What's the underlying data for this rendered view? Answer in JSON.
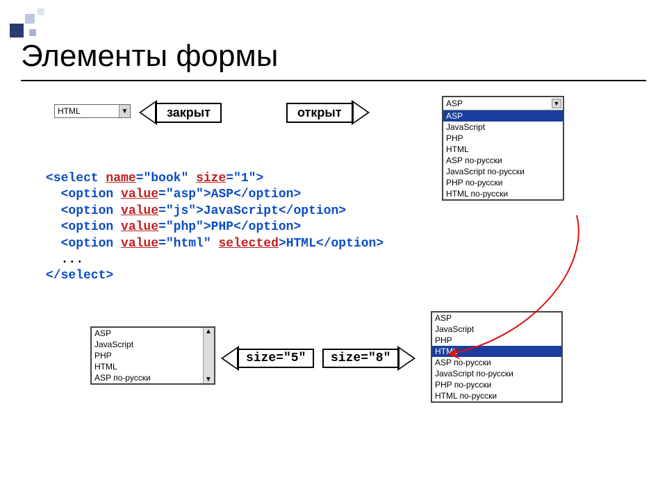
{
  "title": "Элементы формы",
  "labels": {
    "closed": "закрыт",
    "open": "открыт",
    "size5": "size=\"5\"",
    "size8": "size=\"8\""
  },
  "closed_select_value": "HTML",
  "open_listbox": {
    "value": "ASP",
    "selected_index": 0,
    "options": [
      "ASP",
      "JavaScript",
      "PHP",
      "HTML",
      "ASP по-русски",
      "JavaScript по-русски",
      "PHP по-русски",
      "HTML по-русски"
    ]
  },
  "code": {
    "line1_a": "<select ",
    "line1_attr1": "name",
    "line1_b": "=\"book\" ",
    "line1_attr2": "size",
    "line1_c": "=\"1\">",
    "line2_a": "  <option ",
    "line2_attr": "value",
    "line2_b": "=\"asp\">ASP</option>",
    "line3_a": "  <option ",
    "line3_attr": "value",
    "line3_b": "=\"js\">JavaScript</option>",
    "line4_a": "  <option ",
    "line4_attr": "value",
    "line4_b": "=\"php\">PHP</option>",
    "line5_a": "  <option ",
    "line5_attr1": "value",
    "line5_b": "=\"html\" ",
    "line5_attr2": "selected",
    "line5_c": ">HTML</option>",
    "line6": "  ...",
    "line7": "</select>"
  },
  "listbox5": {
    "options": [
      "ASP",
      "JavaScript",
      "PHP",
      "HTML",
      "ASP по-русски"
    ]
  },
  "listbox8": {
    "selected_index": 3,
    "options": [
      "ASP",
      "JavaScript",
      "PHP",
      "HTML",
      "ASP по-русски",
      "JavaScript по-русски",
      "PHP по-русски",
      "HTML по-русски"
    ]
  }
}
